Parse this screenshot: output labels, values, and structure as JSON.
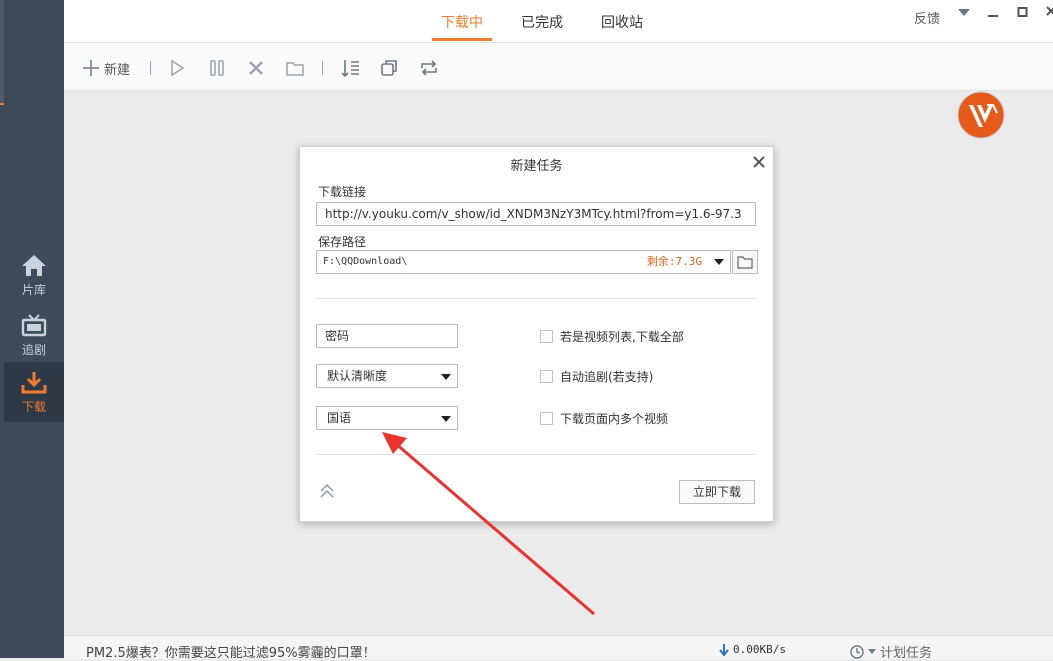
{
  "sidebar": {
    "items": [
      {
        "label": "片库",
        "icon": "home-icon"
      },
      {
        "label": "追剧",
        "icon": "tv-icon"
      },
      {
        "label": "下载",
        "icon": "download-icon"
      }
    ],
    "active": "下载"
  },
  "tabs": [
    {
      "label": "下载中"
    },
    {
      "label": "已完成"
    },
    {
      "label": "回收站"
    }
  ],
  "window": {
    "feedback": "反馈"
  },
  "toolbar": {
    "new_label": "新建"
  },
  "dialog": {
    "title": "新建任务",
    "url_label": "下载链接",
    "url_value": "http://v.youku.com/v_show/id_XNDM3NzY3MTcy.html?from=y1.6-97.3",
    "path_label": "保存路径",
    "path_value": "F:\\QQDownload\\",
    "remaining": "剩余:7.3G",
    "password_placeholder": "密码",
    "quality_value": "默认清晰度",
    "language_value": "国语",
    "options": [
      {
        "label": "若是视频列表,下载全部",
        "checked": false
      },
      {
        "label": "自动追剧(若支持)",
        "checked": false
      },
      {
        "label": "下载页面内多个视频",
        "checked": false
      }
    ],
    "download_button": "立即下载"
  },
  "statusbar": {
    "ad_text": "PM2.5爆表？你需要这只能过滤95%雾霾的口罩！",
    "speed": "0.00KB/s",
    "schedule": "计划任务"
  },
  "colors": {
    "accent": "#f07b2f",
    "sidebar": "#3d4a5a",
    "annotation": "#e8332f"
  }
}
